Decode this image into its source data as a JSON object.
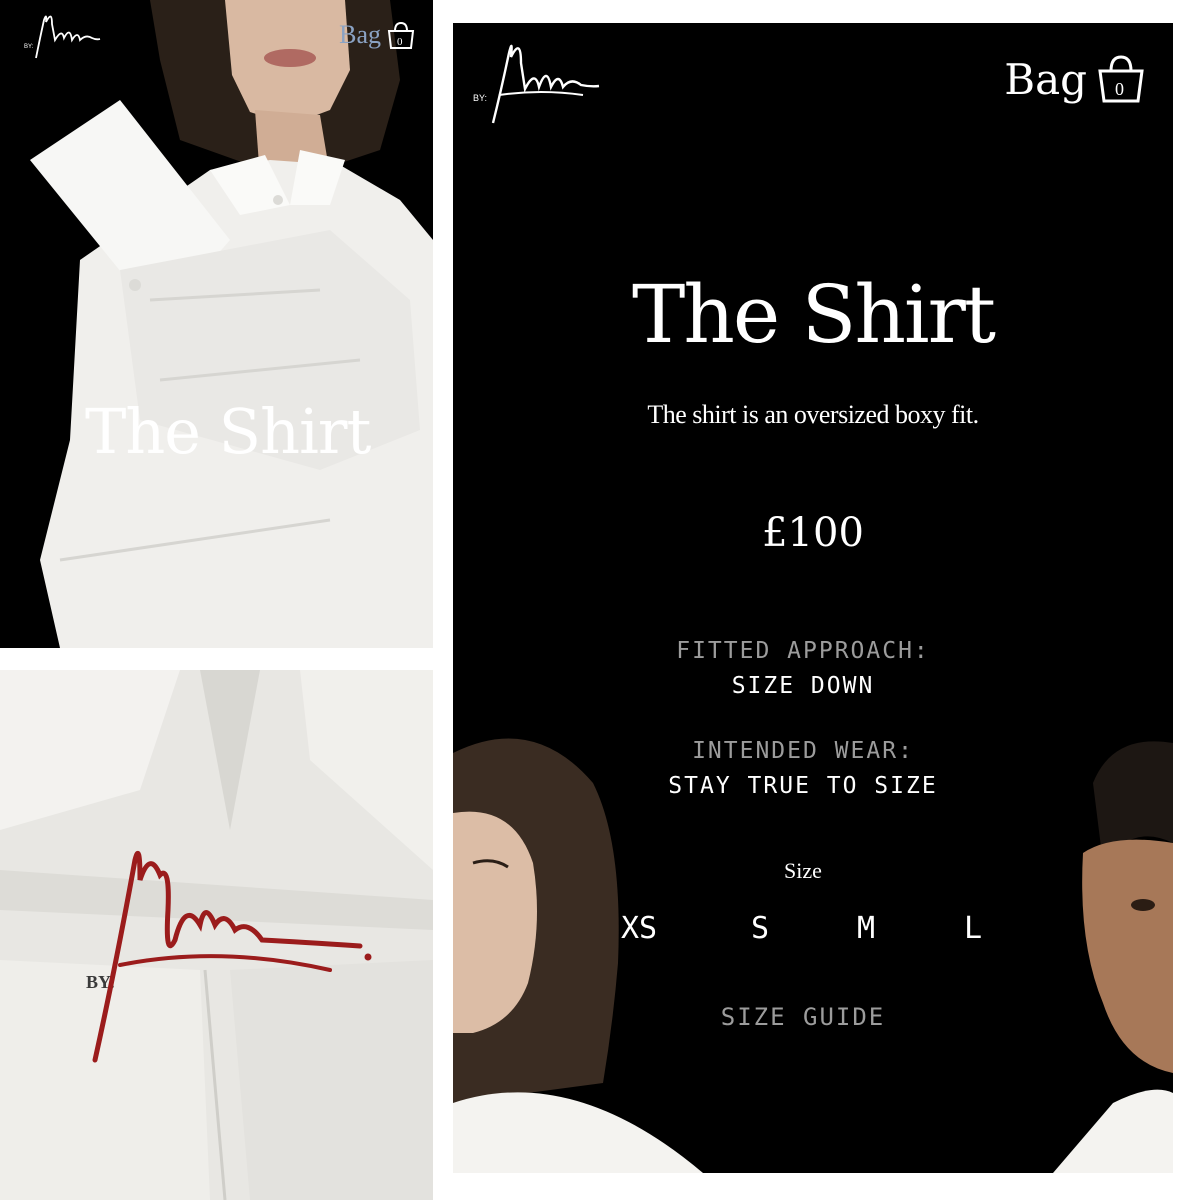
{
  "hero": {
    "title": "The Shirt",
    "bag_label": "Bag",
    "bag_count": "0",
    "logo_prefix": "BY:",
    "logo_signature": "Matthew"
  },
  "closeup": {
    "logo_prefix": "BY:",
    "logo_signature": "Matthew",
    "logo_color": "#9b1c1c"
  },
  "product": {
    "logo_prefix": "BY:",
    "logo_signature": "Matthew",
    "bag_label": "Bag",
    "bag_count": "0",
    "title": "The Shirt",
    "description": "The shirt is an oversized boxy fit.",
    "price": "£100",
    "fitted_label": "FITTED APPROACH:",
    "fitted_value": "SIZE DOWN",
    "intended_label": "INTENDED WEAR:",
    "intended_value": "STAY TRUE TO SIZE",
    "size_heading": "Size",
    "sizes": [
      "XS",
      "S",
      "M",
      "L"
    ],
    "size_guide": "SIZE GUIDE"
  },
  "colors": {
    "background": "#000000",
    "text": "#ffffff",
    "muted": "#9c9c9c",
    "bag_link_small": "#8aa2c3",
    "shirt": "#f2f1ee"
  }
}
